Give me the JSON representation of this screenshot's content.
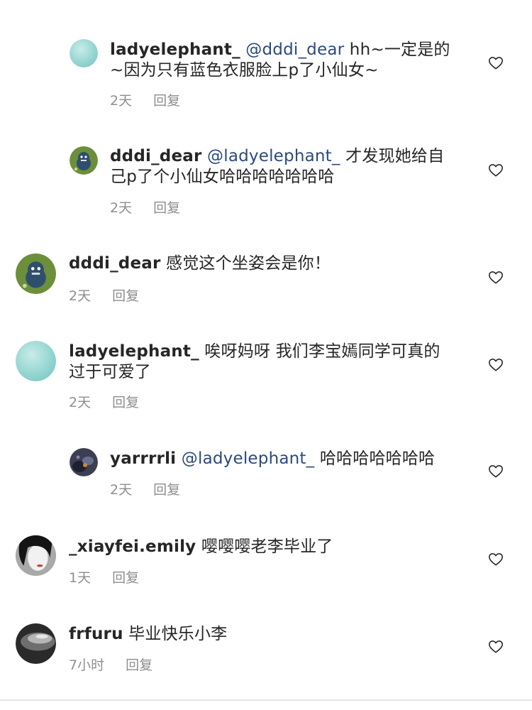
{
  "comments": [
    {
      "username": "ladyelephant_",
      "mention": "@dddi_dear",
      "text": " hh~一定是的~因为只有蓝色衣服脸上p了小仙女~",
      "time": "2天",
      "reply_label": "回复",
      "avatar": "teal-circle"
    },
    {
      "username": "dddi_dear",
      "mention": "@ladyelephant_",
      "text": " 才发现她给自己p了个小仙女哈哈哈哈哈哈哈",
      "time": "2天",
      "reply_label": "回复",
      "avatar": "green-monster"
    },
    {
      "username": "dddi_dear",
      "mention": "",
      "text": " 感觉这个坐姿会是你！",
      "time": "2天",
      "reply_label": "回复",
      "avatar": "green-monster"
    },
    {
      "username": "ladyelephant_",
      "mention": "",
      "text": " 唉呀妈呀 我们李宝嫣同学可真的过于可爱了",
      "time": "2天",
      "reply_label": "回复",
      "avatar": "teal-circle"
    },
    {
      "username": "yarrrrli",
      "mention": "@ladyelephant_",
      "text": " 哈哈哈哈哈哈哈",
      "time": "2天",
      "reply_label": "回复",
      "avatar": "dark-photo"
    },
    {
      "username": "_xiayfei.emily",
      "mention": "",
      "text": " 嘤嘤嘤老李毕业了",
      "time": "1天",
      "reply_label": "回复",
      "avatar": "portrait-photo"
    },
    {
      "username": "frfuru",
      "mention": "",
      "text": " 毕业快乐小李",
      "time": "7小时",
      "reply_label": "回复",
      "avatar": "grey-photo"
    }
  ],
  "icons": {
    "like": "heart-outline-icon"
  },
  "colors": {
    "text": "#262626",
    "mention": "#2b4a7e",
    "meta": "#8e8e8e",
    "avatar_teal": "#8fd3cf",
    "avatar_green": "#6b8f3a"
  }
}
